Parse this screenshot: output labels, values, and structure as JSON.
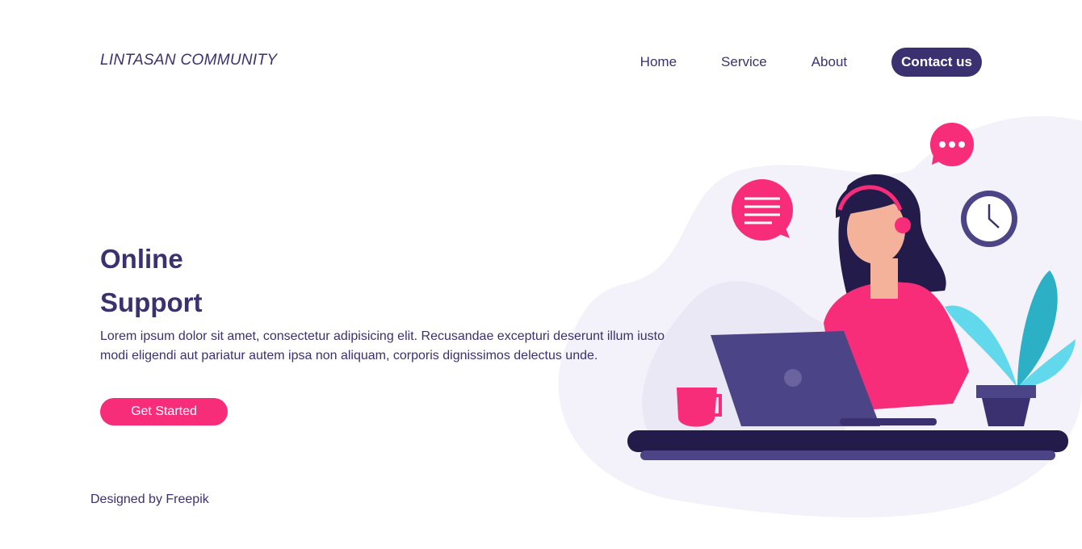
{
  "brand": {
    "part1": "LINTASAN",
    "part2": "COMMUNITY"
  },
  "nav": {
    "items": [
      "Home",
      "Service",
      "About"
    ],
    "contact": "Contact us"
  },
  "hero": {
    "title_line1": "Online",
    "title_line2": "Support",
    "description": "Lorem ipsum dolor sit amet, consectetur adipisicing elit. Recusandae excepturi deserunt illum iusto modi eligendi aut pariatur autem ipsa non aliquam, corporis dignissimos delectus unde.",
    "cta": "Get Started"
  },
  "footer": {
    "credit": "Designed by Freepik"
  },
  "colors": {
    "primary": "#3b3170",
    "accent": "#f72d7a"
  }
}
